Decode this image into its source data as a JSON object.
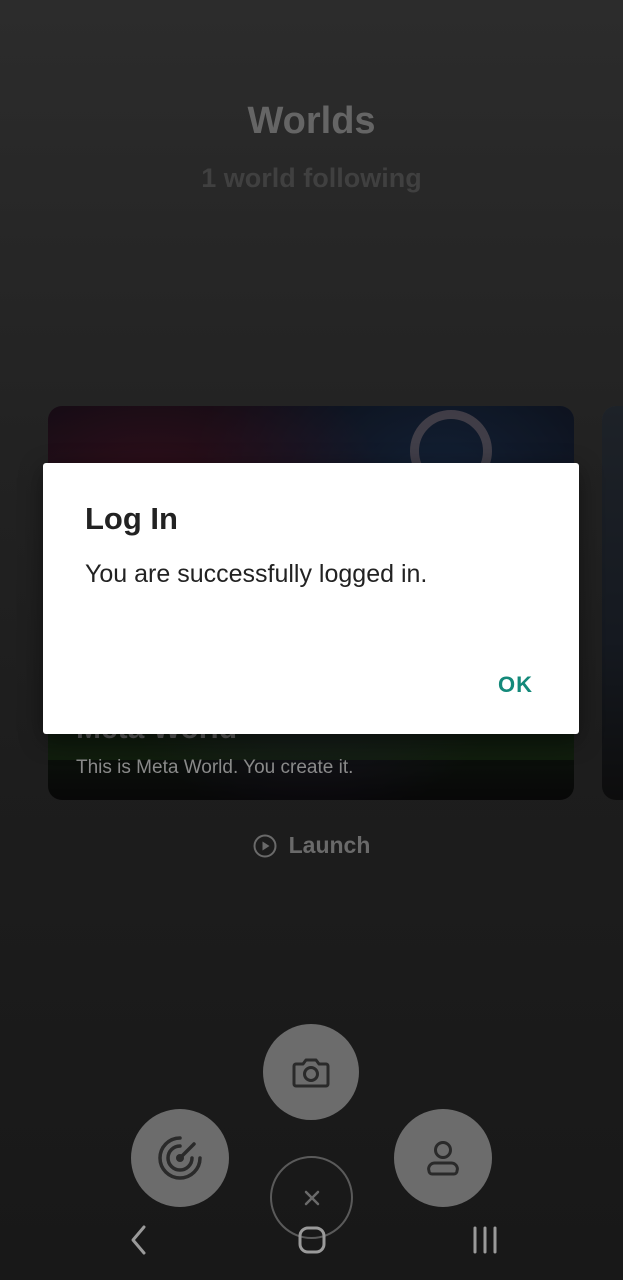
{
  "header": {
    "title": "Worlds",
    "subtitle": "1 world following"
  },
  "cards": [
    {
      "title": "Meta World",
      "description": "This is Meta World. You create it."
    }
  ],
  "launch": {
    "label": "Launch",
    "icon": "play-circle-icon"
  },
  "fab_menu": {
    "icons": [
      "camera-icon",
      "radar-icon",
      "profile-icon",
      "close-icon"
    ]
  },
  "nav_bar": {
    "icons": [
      "back-icon",
      "home-icon",
      "recents-icon"
    ]
  },
  "dialog": {
    "title": "Log In",
    "message": "You are successfully logged in.",
    "ok_label": "OK",
    "accent_color": "#14897a"
  }
}
